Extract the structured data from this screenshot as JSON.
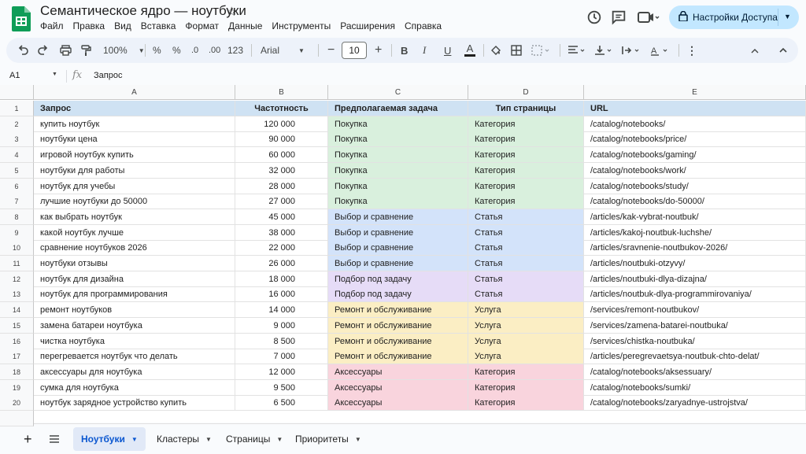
{
  "doc": {
    "title": "Семантическое ядро — ноутбуки"
  },
  "menu": [
    "Файл",
    "Правка",
    "Вид",
    "Вставка",
    "Формат",
    "Данные",
    "Инструменты",
    "Расширения",
    "Справка"
  ],
  "share": {
    "label": "Настройки Доступа"
  },
  "toolbar": {
    "zoom": "100%",
    "percent": "%",
    "dec_decrease": ".0",
    "dec_increase": ".00",
    "number_format": "123",
    "font": "Arial",
    "font_size": "10",
    "bold": "B",
    "italic": "I",
    "underline": "U",
    "text_color": "A"
  },
  "formula_bar": {
    "cell_ref": "A1",
    "fx": "fx",
    "value": "Запрос"
  },
  "columns": [
    "A",
    "B",
    "C",
    "D",
    "E"
  ],
  "header_row": [
    "Запрос",
    "Частотность",
    "Предполагаемая задача",
    "Тип страницы",
    "URL"
  ],
  "category_colors": {
    "Покупка": "#d9f0dd",
    "Выбор и сравнение": "#d3e3fa",
    "Подбор под задачу": "#e6dcf7",
    "Ремонт и обслуживание": "#fbeec4",
    "Аксессуары": "#f9d4dd"
  },
  "rows": [
    [
      "купить ноутбук",
      "120 000",
      "Покупка",
      "Категория",
      "/catalog/notebooks/"
    ],
    [
      "ноутбуки цена",
      "90 000",
      "Покупка",
      "Категория",
      "/catalog/notebooks/price/"
    ],
    [
      "игровой ноутбук купить",
      "60 000",
      "Покупка",
      "Категория",
      "/catalog/notebooks/gaming/"
    ],
    [
      "ноутбуки для работы",
      "32 000",
      "Покупка",
      "Категория",
      "/catalog/notebooks/work/"
    ],
    [
      "ноутбук для учебы",
      "28 000",
      "Покупка",
      "Категория",
      "/catalog/notebooks/study/"
    ],
    [
      "лучшие ноутбуки до 50000",
      "27 000",
      "Покупка",
      "Категория",
      "/catalog/notebooks/do-50000/"
    ],
    [
      "как выбрать ноутбук",
      "45 000",
      "Выбор и сравнение",
      "Статья",
      "/articles/kak-vybrat-noutbuk/"
    ],
    [
      "какой ноутбук лучше",
      "38 000",
      "Выбор и сравнение",
      "Статья",
      "/articles/kakoj-noutbuk-luchshe/"
    ],
    [
      "сравнение ноутбуков 2026",
      "22 000",
      "Выбор и сравнение",
      "Статья",
      "/articles/sravnenie-noutbukov-2026/"
    ],
    [
      "ноутбуки отзывы",
      "26 000",
      "Выбор и сравнение",
      "Статья",
      "/articles/noutbuki-otzyvy/"
    ],
    [
      "ноутбук для дизайна",
      "18 000",
      "Подбор под задачу",
      "Статья",
      "/articles/noutbuki-dlya-dizajna/"
    ],
    [
      "ноутбук для программирования",
      "16 000",
      "Подбор под задачу",
      "Статья",
      "/articles/noutbuk-dlya-programmirovaniya/"
    ],
    [
      "ремонт ноутбуков",
      "14 000",
      "Ремонт и обслуживание",
      "Услуга",
      "/services/remont-noutbukov/"
    ],
    [
      "замена батареи ноутбука",
      "9 000",
      "Ремонт и обслуживание",
      "Услуга",
      "/services/zamena-batarei-noutbuka/"
    ],
    [
      "чистка ноутбука",
      "8 500",
      "Ремонт и обслуживание",
      "Услуга",
      "/services/chistka-noutbuka/"
    ],
    [
      "перегревается ноутбук что делать",
      "7 000",
      "Ремонт и обслуживание",
      "Услуга",
      "/articles/peregrevaetsya-noutbuk-chto-delat/"
    ],
    [
      "аксессуары для ноутбука",
      "12 000",
      "Аксессуары",
      "Категория",
      "/catalog/notebooks/aksessuary/"
    ],
    [
      "сумка для ноутбука",
      "9 500",
      "Аксессуары",
      "Категория",
      "/catalog/notebooks/sumki/"
    ],
    [
      "ноутбук зарядное устройство купить",
      "6 500",
      "Аксессуары",
      "Категория",
      "/catalog/notebooks/zaryadnye-ustrojstva/"
    ]
  ],
  "sheets": [
    {
      "name": "Ноутбуки",
      "active": true
    },
    {
      "name": "Кластеры",
      "active": false
    },
    {
      "name": "Страницы",
      "active": false
    },
    {
      "name": "Приоритеты",
      "active": false
    }
  ]
}
